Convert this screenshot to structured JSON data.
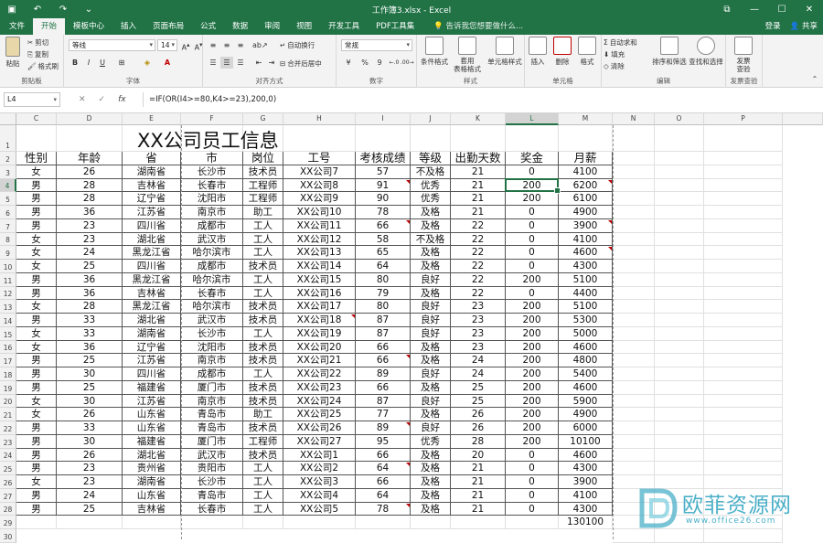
{
  "window": {
    "title": "工作簿3.xlsx - Excel",
    "quick_access": [
      "save",
      "undo",
      "redo",
      "customize"
    ]
  },
  "tabs": [
    "文件",
    "开始",
    "模板中心",
    "插入",
    "页面布局",
    "公式",
    "数据",
    "审阅",
    "视图",
    "开发工具",
    "PDF工具集"
  ],
  "active_tab": "开始",
  "tell_me": "告诉我您想要做什么...",
  "account": {
    "login": "登录",
    "share": "共享"
  },
  "ribbon": {
    "clipboard": {
      "paste": "粘贴",
      "cut": "剪切",
      "copy": "复制",
      "format_painter": "格式刷",
      "label": "剪贴板"
    },
    "font": {
      "font_name": "等线",
      "font_size": "14",
      "bold": "B",
      "italic": "I",
      "underline": "U",
      "font_color": "A",
      "label": "字体"
    },
    "alignment": {
      "wrap": "自动换行",
      "merge": "合并后居中",
      "label": "对齐方式"
    },
    "number": {
      "format": "常规",
      "percent": "%",
      "comma": "9",
      "label": "数字"
    },
    "styles": {
      "conditional": "条件格式",
      "table": "套用\n表格格式",
      "cell_styles": "单元格样式",
      "label": "样式"
    },
    "cells": {
      "insert": "插入",
      "delete": "删除",
      "format": "格式",
      "label": "单元格"
    },
    "editing": {
      "autosum": "自动求和",
      "fill": "填充",
      "clear": "清除",
      "sort": "排序和筛选",
      "find": "查找和选择",
      "label": "编辑"
    },
    "review": {
      "invoice": "发票\n查验",
      "label": "发票查验"
    }
  },
  "formula_bar": {
    "name_box": "L4",
    "cancel": "✕",
    "enter": "✓",
    "fx": "fx",
    "formula": "=IF(OR(I4>=80,K4>=23),200,0)"
  },
  "columns": [
    "C",
    "D",
    "E",
    "F",
    "G",
    "H",
    "I",
    "J",
    "K",
    "L",
    "M",
    "N",
    "O",
    "P"
  ],
  "selected_column": "L",
  "selected_row": 4,
  "sheet": {
    "title": "XX公司员工信息",
    "headers": [
      "性别",
      "年龄",
      "省",
      "市",
      "岗位",
      "工号",
      "考核成绩",
      "等级",
      "出勤天数",
      "奖金",
      "月薪"
    ],
    "rows": [
      [
        "女",
        "26",
        "湖南省",
        "长沙市",
        "技术员",
        "XX公司7",
        "57",
        "不及格",
        "21",
        "0",
        "4100"
      ],
      [
        "男",
        "28",
        "吉林省",
        "长春市",
        "工程师",
        "XX公司8",
        "91",
        "优秀",
        "21",
        "200",
        "6200"
      ],
      [
        "男",
        "28",
        "辽宁省",
        "沈阳市",
        "工程师",
        "XX公司9",
        "90",
        "优秀",
        "21",
        "200",
        "6100"
      ],
      [
        "男",
        "36",
        "江苏省",
        "南京市",
        "助工",
        "XX公司10",
        "78",
        "及格",
        "21",
        "0",
        "4900"
      ],
      [
        "男",
        "23",
        "四川省",
        "成都市",
        "工人",
        "XX公司11",
        "66",
        "及格",
        "22",
        "0",
        "3900"
      ],
      [
        "女",
        "23",
        "湖北省",
        "武汉市",
        "工人",
        "XX公司12",
        "58",
        "不及格",
        "22",
        "0",
        "4100"
      ],
      [
        "女",
        "24",
        "黑龙江省",
        "哈尔滨市",
        "工人",
        "XX公司13",
        "65",
        "及格",
        "22",
        "0",
        "4600"
      ],
      [
        "女",
        "25",
        "四川省",
        "成都市",
        "技术员",
        "XX公司14",
        "64",
        "及格",
        "22",
        "0",
        "4300"
      ],
      [
        "男",
        "36",
        "黑龙江省",
        "哈尔滨市",
        "工人",
        "XX公司15",
        "80",
        "良好",
        "22",
        "200",
        "5100"
      ],
      [
        "男",
        "36",
        "吉林省",
        "长春市",
        "工人",
        "XX公司16",
        "79",
        "及格",
        "22",
        "0",
        "4400"
      ],
      [
        "女",
        "28",
        "黑龙江省",
        "哈尔滨市",
        "技术员",
        "XX公司17",
        "80",
        "良好",
        "23",
        "200",
        "5100"
      ],
      [
        "男",
        "33",
        "湖北省",
        "武汉市",
        "技术员",
        "XX公司18",
        "87",
        "良好",
        "23",
        "200",
        "5300"
      ],
      [
        "女",
        "33",
        "湖南省",
        "长沙市",
        "工人",
        "XX公司19",
        "87",
        "良好",
        "23",
        "200",
        "5000"
      ],
      [
        "女",
        "36",
        "辽宁省",
        "沈阳市",
        "技术员",
        "XX公司20",
        "66",
        "及格",
        "23",
        "200",
        "4600"
      ],
      [
        "男",
        "25",
        "江苏省",
        "南京市",
        "技术员",
        "XX公司21",
        "66",
        "及格",
        "24",
        "200",
        "4800"
      ],
      [
        "男",
        "30",
        "四川省",
        "成都市",
        "工人",
        "XX公司22",
        "89",
        "良好",
        "24",
        "200",
        "5400"
      ],
      [
        "男",
        "25",
        "福建省",
        "厦门市",
        "技术员",
        "XX公司23",
        "66",
        "及格",
        "25",
        "200",
        "4600"
      ],
      [
        "女",
        "30",
        "江苏省",
        "南京市",
        "技术员",
        "XX公司24",
        "87",
        "良好",
        "25",
        "200",
        "5900"
      ],
      [
        "女",
        "26",
        "山东省",
        "青岛市",
        "助工",
        "XX公司25",
        "77",
        "及格",
        "26",
        "200",
        "4900"
      ],
      [
        "男",
        "33",
        "山东省",
        "青岛市",
        "技术员",
        "XX公司26",
        "89",
        "良好",
        "26",
        "200",
        "6000"
      ],
      [
        "男",
        "30",
        "福建省",
        "厦门市",
        "工程师",
        "XX公司27",
        "95",
        "优秀",
        "28",
        "200",
        "10100"
      ],
      [
        "男",
        "26",
        "湖北省",
        "武汉市",
        "技术员",
        "XX公司1",
        "66",
        "及格",
        "20",
        "0",
        "4600"
      ],
      [
        "男",
        "23",
        "贵州省",
        "贵阳市",
        "工人",
        "XX公司2",
        "64",
        "及格",
        "21",
        "0",
        "4300"
      ],
      [
        "女",
        "23",
        "湖南省",
        "长沙市",
        "工人",
        "XX公司3",
        "66",
        "及格",
        "21",
        "0",
        "3900"
      ],
      [
        "男",
        "24",
        "山东省",
        "青岛市",
        "工人",
        "XX公司4",
        "64",
        "及格",
        "21",
        "0",
        "4100"
      ],
      [
        "男",
        "25",
        "吉林省",
        "长春市",
        "工人",
        "XX公司5",
        "78",
        "及格",
        "21",
        "0",
        "4300"
      ]
    ],
    "total": "130100"
  },
  "watermark": {
    "main": "欧菲资源网",
    "sub": "www.office26.com"
  },
  "colors": {
    "excel_green": "#217346",
    "watermark": "#4bb0c8",
    "comment_marker": "#c00000"
  }
}
